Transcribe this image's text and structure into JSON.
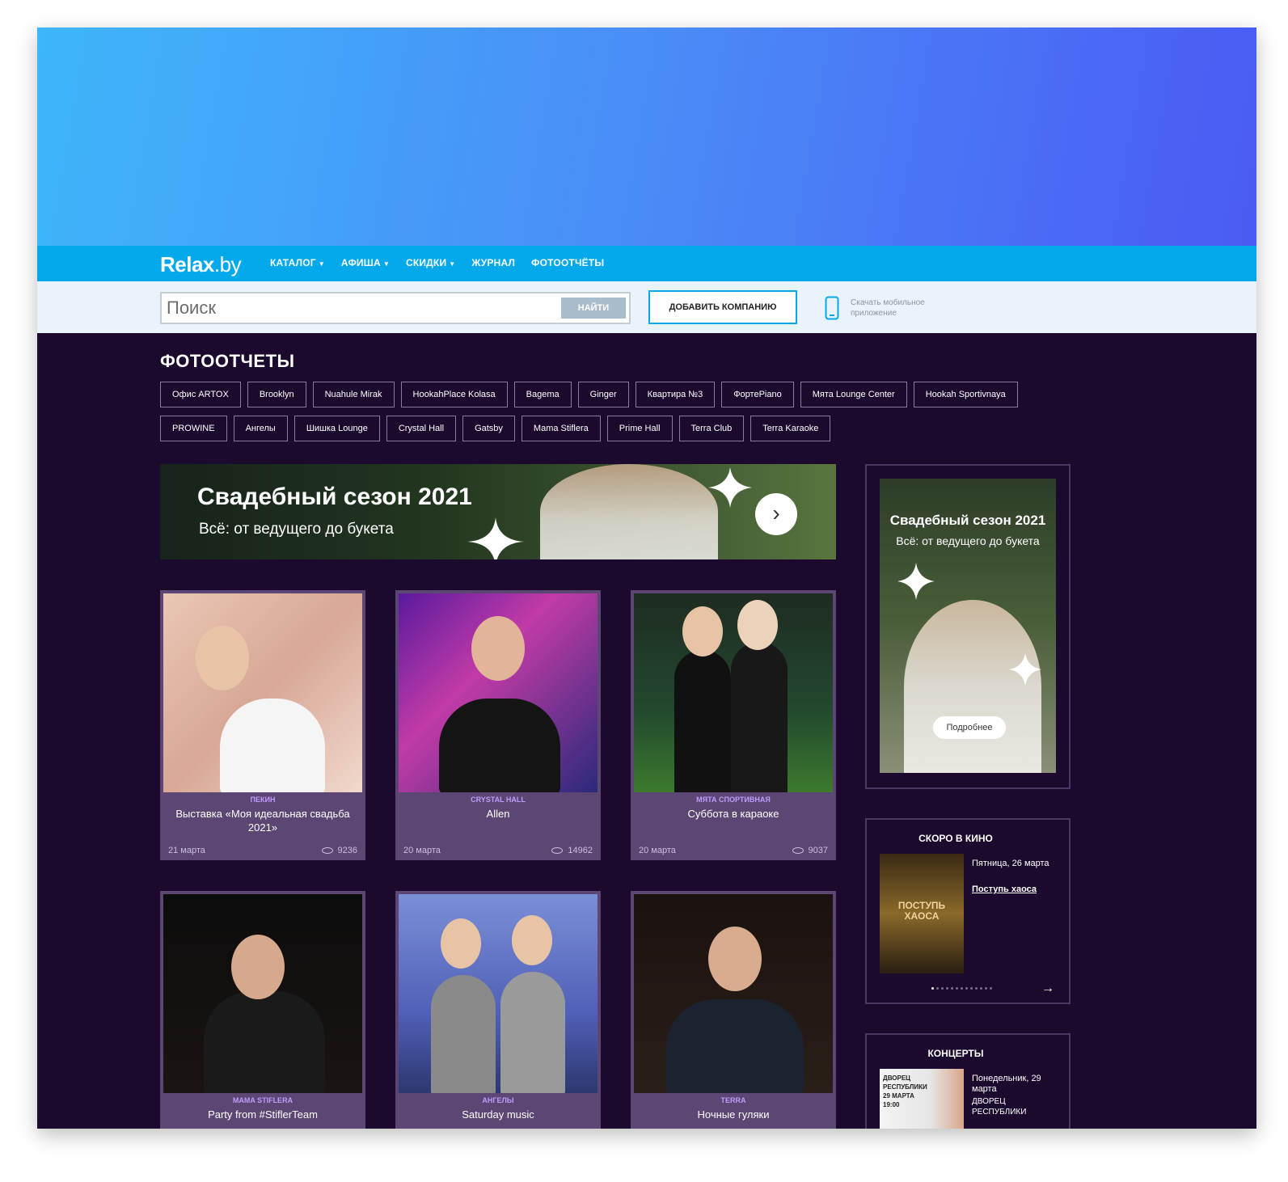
{
  "header": {
    "logo_bold": "Relax",
    "logo_rest": ".by",
    "nav": [
      {
        "label": "КАТАЛОГ",
        "caret": true
      },
      {
        "label": "АФИША",
        "caret": true
      },
      {
        "label": "СКИДКИ",
        "caret": true
      },
      {
        "label": "ЖУРНАЛ",
        "caret": false
      },
      {
        "label": "ФОТООТЧЁТЫ",
        "caret": false
      }
    ]
  },
  "search": {
    "placeholder": "Поиск",
    "button_label": "НАЙТИ",
    "add_company_label": "ДОБАВИТЬ КОМПАНИЮ",
    "app_text": "Скачать мобильное приложение"
  },
  "section": {
    "title": "ФОТООТЧЕТЫ",
    "tags": [
      "Офис ARTOX",
      "Brooklyn",
      "Nuahule Mirak",
      "HookahPlace Kolasa",
      "Bagema",
      "Ginger",
      "Квартира №3",
      "ФортеPiano",
      "Мята Lounge Center",
      "Hookah Sportivnaya",
      "PROWINE",
      "Ангелы",
      "Шишка Lounge",
      "Crystal Hall",
      "Gatsby",
      "Mama Stiflera",
      "Prime Hall",
      "Terra Club",
      "Terra Karaoke"
    ]
  },
  "banner": {
    "title": "Свадебный сезон 2021",
    "subtitle": "Всё: от ведущего до букета",
    "arrow": "›"
  },
  "cards": [
    {
      "venue": "ПЕКИН",
      "title": "Выставка «Моя идеальная свадьба 2021»",
      "date": "21 марта",
      "views": "9236"
    },
    {
      "venue": "CRYSTAL HALL",
      "title": "Allen",
      "date": "20 марта",
      "views": "14962"
    },
    {
      "venue": "МЯТА СПОРТИВНАЯ",
      "title": "Суббота в караоке",
      "date": "20 марта",
      "views": "9037"
    },
    {
      "venue": "MAMA STIFLERA",
      "title": "Party from #StiflerTeam",
      "date": "",
      "views": ""
    },
    {
      "venue": "АНГЕЛЫ",
      "title": "Saturday music",
      "date": "",
      "views": ""
    },
    {
      "venue": "TERRA",
      "title": "Ночные гуляки",
      "date": "",
      "views": ""
    }
  ],
  "side_banner": {
    "title": "Свадебный сезон 2021",
    "subtitle": "Всё: от ведущего до букета",
    "button": "Подробнее"
  },
  "cinema": {
    "heading": "СКОРО В КИНО",
    "date": "Пятница, 26 марта",
    "film": "Поступь хаоса",
    "poster_title": "ПОСТУПЬ ХАОСА",
    "next": "→"
  },
  "concerts": {
    "heading": "КОНЦЕРТЫ",
    "date": "Понедельник, 29 марта",
    "place": "ДВОРЕЦ РЕСПУБЛИКИ",
    "poster_text": "ДВОРЕЦ РЕСПУБЛИКИ 29 МАРТА 19:00"
  },
  "colors": {
    "hero_start": "#3eb6fb",
    "hero_end": "#4a5af4",
    "nav_bg": "#04a9ec",
    "page_bg": "#1b0a2e",
    "card_bg": "#5b4674",
    "venue_accent": "#c19bfb"
  }
}
